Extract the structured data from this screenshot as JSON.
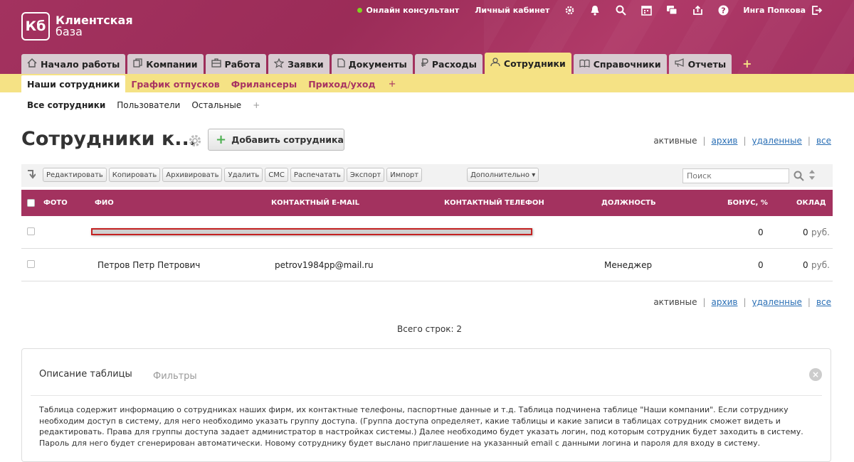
{
  "app": {
    "logo_short": "Кб",
    "logo_line1": "Клиентская",
    "logo_line2": "база"
  },
  "topbar": {
    "online": "Онлайн консультант",
    "cabinet": "Личный кабинет",
    "user": "Инга Попкова",
    "icons": [
      "gear-icon",
      "bell-icon",
      "search-icon",
      "calendar-icon",
      "chat-icon",
      "export-icon",
      "help-icon",
      "logout-icon"
    ]
  },
  "tabs": [
    {
      "label": "Начало работы",
      "icon": "home-icon"
    },
    {
      "label": "Компании",
      "icon": "copy-icon"
    },
    {
      "label": "Работа",
      "icon": "briefcase-icon"
    },
    {
      "label": "Заявки",
      "icon": "star-icon"
    },
    {
      "label": "Документы",
      "icon": "document-icon"
    },
    {
      "label": "Расходы",
      "icon": "ruble-icon"
    },
    {
      "label": "Сотрудники",
      "icon": "people-icon",
      "active": true
    },
    {
      "label": "Справочники",
      "icon": "book-icon"
    },
    {
      "label": "Отчеты",
      "icon": "megaphone-icon"
    }
  ],
  "tab_plus": "+",
  "subtabs": [
    "Наши сотрудники",
    "График отпусков",
    "Фрилансеры",
    "Приход/уход"
  ],
  "subtab_plus": "+",
  "filters": [
    "Все сотрудники",
    "Пользователи",
    "Остальные",
    "+"
  ],
  "page": {
    "title": "Сотрудники к...",
    "add_button": "Добавить сотрудника"
  },
  "view_links": {
    "active": "активные",
    "archive": "архив",
    "deleted": "удаленные",
    "all": "все",
    "sep": "|"
  },
  "toolbar": {
    "buttons": [
      "Редактировать",
      "Копировать",
      "Архивировать",
      "Удалить",
      "СМС",
      "Распечатать",
      "Экспорт",
      "Импорт"
    ],
    "more": "Дополнительно ▾",
    "search_placeholder": "Поиск"
  },
  "table": {
    "columns": [
      "ФОТО",
      "ФИО",
      "КОНТАКТНЫЙ E-MAIL",
      "КОНТАКТНЫЙ ТЕЛЕФОН",
      "ДОЛЖНОСТЬ",
      "БОНУС, %",
      "ОКЛАД"
    ],
    "rows": [
      {
        "name": "",
        "email": "",
        "phone": "",
        "position": "",
        "bonus": "0",
        "salary": "0",
        "currency": "руб."
      },
      {
        "name": "Петров Петр Петрович",
        "email": "petrov1984pp@mail.ru",
        "phone": "",
        "position": "Менеджер",
        "bonus": "0",
        "salary": "0",
        "currency": "руб."
      }
    ],
    "total": "Всего строк: 2"
  },
  "panel": {
    "tab_description": "Описание таблицы",
    "tab_filters": "Фильтры",
    "close": "×",
    "description": "Таблица содержит информацию о сотрудниках наших фирм, их контактные телефоны, паспортные данные и т.д. Таблица подчинена таблице \"Наши компании\". Если сотруднику необходим доступ в систему, для него необходимо указать группу доступа. (Группа доступа определяет, какие таблицы и какие записи в таблицах сотрудник сможет видеть и редактировать. Права для группы доступа задает администратор в настройках системы.) Далее необходимо будет указать логин, под которым сотрудник будет заходить в систему. Пароль для него будет сгенерирован автоматически. Новому сотруднику будет выслано приглашение на указанный email с данными логина и пароля для входу в систему."
  },
  "colors": {
    "brand": "#a3325f",
    "accent": "#f5e285",
    "link": "#2a6fb5"
  }
}
